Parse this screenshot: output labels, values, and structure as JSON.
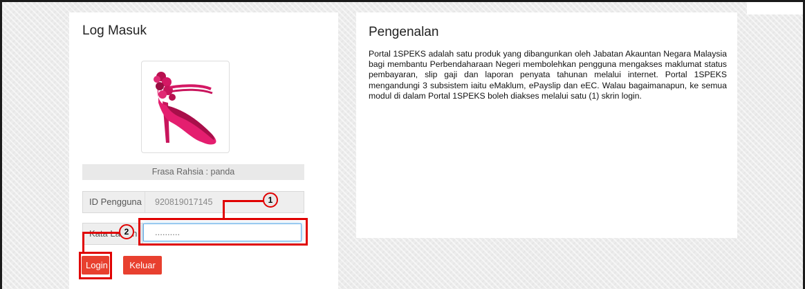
{
  "login": {
    "title": "Log Masuk",
    "security_phrase": "Frasa Rahsia : panda",
    "user_id_label": "ID Pengguna",
    "user_id_value": "920819017145",
    "password_label": "Kata Laluan",
    "password_value": "..........",
    "login_button": "Login",
    "exit_button": "Keluar",
    "security_image": "pink-high-heel-shoe"
  },
  "intro": {
    "title": "Pengenalan",
    "body": "Portal 1SPEKS adalah satu produk yang dibangunkan oleh Jabatan Akauntan Negara Malaysia bagi membantu Perbendaharaan Negeri membolehkan pengguna mengakses maklumat status pembayaran, slip gaji dan laporan penyata tahunan melalui internet. Portal 1SPEKS mengandungi 3 subsistem iaitu eMaklum, ePayslip dan eEC. Walau bagaimanapun, ke semua modul di dalam Portal 1SPEKS boleh diakses melalui satu (1) skrin login."
  },
  "annotations": {
    "step1": "1",
    "step2": "2",
    "color": "#e00000"
  },
  "colors": {
    "button": "#e8402f",
    "focus": "#66afe9"
  }
}
